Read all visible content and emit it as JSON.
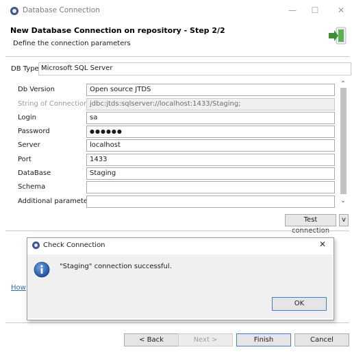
{
  "window": {
    "title": "Database Connection",
    "controls": {
      "minimize": "—",
      "maximize": "☐",
      "close": "✕"
    }
  },
  "header": {
    "title": "New Database Connection on repository - Step 2/2",
    "subtitle": "Define the connection parameters"
  },
  "db_type": {
    "label": "DB Type",
    "value": "Microsoft SQL Server"
  },
  "form": {
    "db_version": {
      "label": "Db Version",
      "value": "Open source JTDS"
    },
    "connection_string": {
      "label": "String of Connection",
      "value": "jdbc:jtds:sqlserver://localhost:1433/Staging;"
    },
    "login": {
      "label": "Login",
      "value": "sa"
    },
    "password": {
      "label": "Password",
      "value": "●●●●●●"
    },
    "server": {
      "label": "Server",
      "value": "localhost"
    },
    "port": {
      "label": "Port",
      "value": "1433"
    },
    "database": {
      "label": "DataBase",
      "value": "Staging"
    },
    "schema": {
      "label": "Schema",
      "value": ""
    },
    "additional": {
      "label": "Additional parameters",
      "value": ""
    }
  },
  "actions": {
    "test_connection": "Test connection",
    "expand": "v"
  },
  "help_link": "How",
  "modal": {
    "title": "Check Connection",
    "close": "✕",
    "message": "\"Staging\" connection successful.",
    "ok": "OK"
  },
  "footer": {
    "back": "< Back",
    "next": "Next >",
    "finish": "Finish",
    "cancel": "Cancel"
  },
  "colors": {
    "accent": "#3c7fd1",
    "link": "#2e6fc1",
    "dialog_bg": "#f0f0f0",
    "info_icon": "#2a62b8"
  }
}
